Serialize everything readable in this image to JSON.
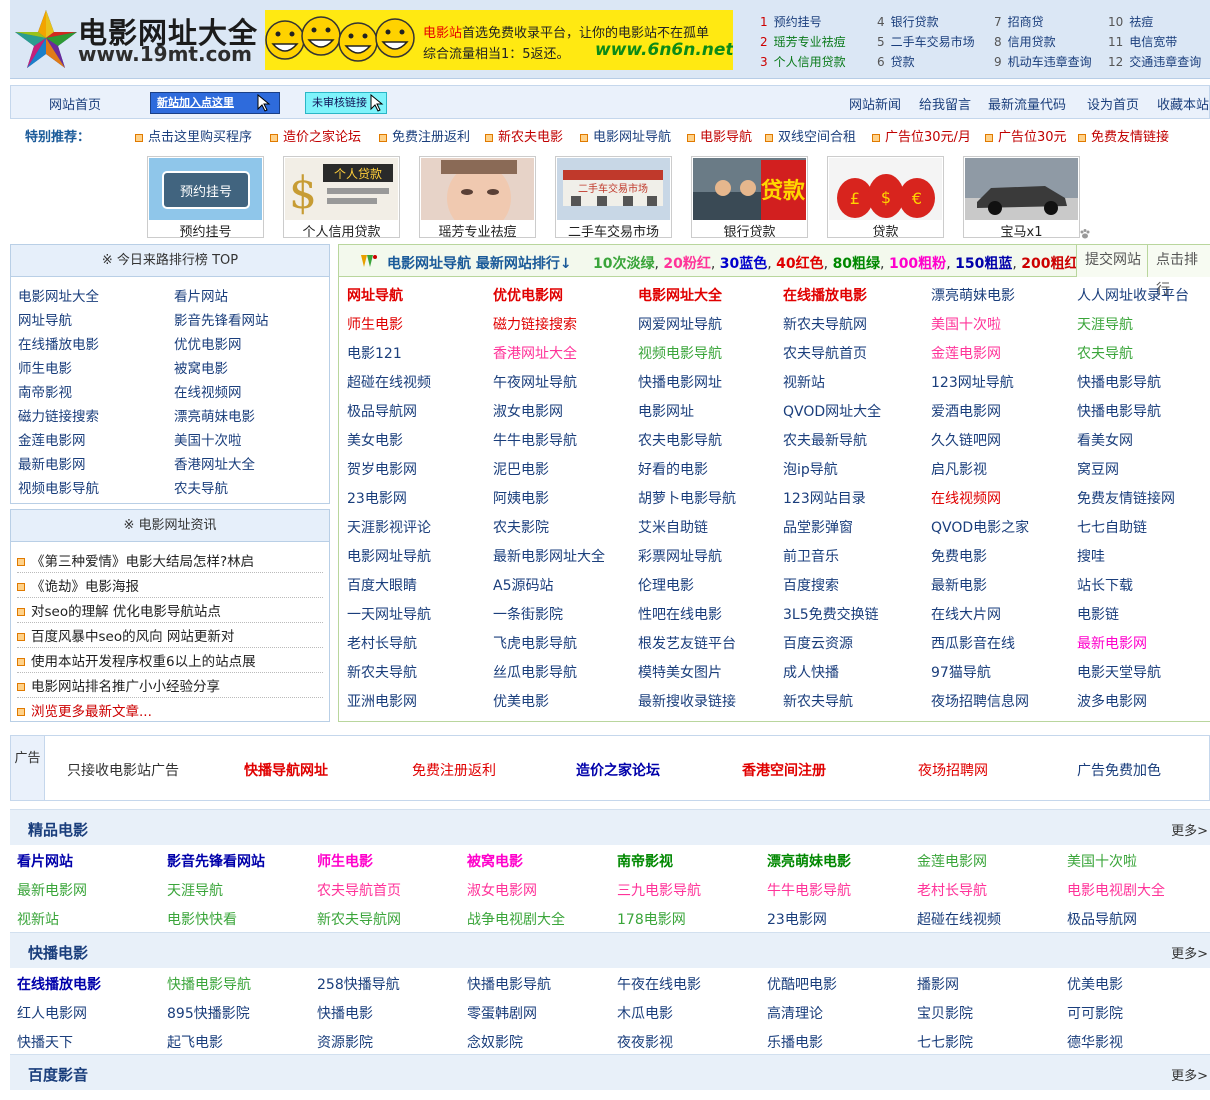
{
  "header": {
    "logo_title": "电影网址大全",
    "logo_url": "www.19mt.com",
    "banner": {
      "line1_highlight": "电影站",
      "line1_rest": "首选免费收录平台，让你的电影站不在孤单",
      "line2": "综合流量相当1：5返还。",
      "url": "www.6n6n.net"
    },
    "toplinks": [
      {
        "num": "1",
        "label": "预约挂号"
      },
      {
        "num": "2",
        "label": "瑶芳专业祛痘"
      },
      {
        "num": "3",
        "label": "个人信用贷款"
      },
      {
        "num": "4",
        "label": "银行贷款"
      },
      {
        "num": "5",
        "label": "二手车交易市场"
      },
      {
        "num": "6",
        "label": "贷款"
      },
      {
        "num": "7",
        "label": "招商贷"
      },
      {
        "num": "8",
        "label": "信用贷款"
      },
      {
        "num": "9",
        "label": "机动车违章查询"
      },
      {
        "num": "10",
        "label": "祛痘"
      },
      {
        "num": "11",
        "label": "电信宽带"
      },
      {
        "num": "12",
        "label": "交通违章查询"
      }
    ]
  },
  "nav": {
    "home": "网站首页",
    "add_site": "新站加入点这里",
    "unreviewed": "未审核链接",
    "right": [
      "网站新闻",
      "给我留言",
      "最新流量代码",
      "设为首页",
      "收藏本站"
    ]
  },
  "special": {
    "title": "特别推荐：",
    "items": [
      {
        "label": "点击这里购买程序",
        "color": "#1a3e7c"
      },
      {
        "label": "造价之家论坛",
        "color": "#c00000"
      },
      {
        "label": "免费注册返利",
        "color": "#1a3e7c"
      },
      {
        "label": "新农夫电影",
        "color": "#c00000"
      },
      {
        "label": "电影网址导航",
        "color": "#1a3e7c"
      },
      {
        "label": "电影导航",
        "color": "#c00000"
      },
      {
        "label": "双线空间合租",
        "color": "#1a3e7c"
      },
      {
        "label": "广告位30元/月",
        "color": "#c00000"
      },
      {
        "label": "广告位30元",
        "color": "#c00000"
      },
      {
        "label": "免费友情链接",
        "color": "#c00000"
      }
    ]
  },
  "thumbs": [
    {
      "caption": "预约挂号",
      "img_text": "预约挂号"
    },
    {
      "caption": "个人信用贷款",
      "img_text": "个人贷款"
    },
    {
      "caption": "瑶芳专业祛痘",
      "img_text": ""
    },
    {
      "caption": "二手车交易市场",
      "img_text": "二手车交易市场"
    },
    {
      "caption": "银行贷款",
      "img_text": "贷款"
    },
    {
      "caption": "贷款",
      "img_text": ""
    },
    {
      "caption": "宝马x1",
      "img_text": ""
    }
  ],
  "rank": {
    "title": "※ 今日来路排行榜 TOP",
    "items": [
      "电影网址大全",
      "看片网站",
      "网址导航",
      "影音先锋看网站",
      "在线播放电影",
      "优优电影网",
      "师生电影",
      "被窝电影",
      "南帝影视",
      "在线视频网",
      "磁力链接搜索",
      "漂亮萌妹电影",
      "金莲电影网",
      "美国十次啦",
      "最新电影网",
      "香港网址大全",
      "视频电影导航",
      "农夫导航"
    ]
  },
  "news": {
    "title": "※ 电影网址资讯",
    "items": [
      "《第三种爱情》电影大结局怎样?林启",
      "《诡劫》电影海报",
      "对seo的理解 优化电影导航站点",
      "百度风暴中seo的风向 网站更新对",
      "使用本站开发程序权重6以上的站点展",
      "电影网站排名推广小小经验分享",
      "浏览更多最新文章..."
    ]
  },
  "main": {
    "title": "电影网址导航 最新网站排行↓",
    "legend": [
      {
        "text": "10次淡绿",
        "color": "#3aa53a"
      },
      {
        "text": "20粉红",
        "color": "#ff3399"
      },
      {
        "text": "30蓝色",
        "color": "#0000cc"
      },
      {
        "text": "40红色",
        "color": "#e00000"
      },
      {
        "text": "80粗绿",
        "color": "#008800"
      },
      {
        "text": "100粗粉",
        "color": "#ff00cc"
      },
      {
        "text": "150粗蓝",
        "color": "#0000aa"
      },
      {
        "text": "200粗红",
        "color": "#cc0000"
      }
    ],
    "tab_submit": "提交网站",
    "tab_rank": "点击排行",
    "links": [
      [
        {
          "t": "网址导航",
          "c": "#e00000",
          "b": true
        },
        {
          "t": "优优电影网",
          "c": "#e00000",
          "b": true
        },
        {
          "t": "电影网址大全",
          "c": "#e00000",
          "b": true
        },
        {
          "t": "在线播放电影",
          "c": "#e00000",
          "b": true
        },
        {
          "t": "漂亮萌妹电影",
          "c": "#1a3e7c"
        },
        {
          "t": "人人网址收录平台",
          "c": "#1a3e7c"
        }
      ],
      [
        {
          "t": "师生电影",
          "c": "#e00000"
        },
        {
          "t": "磁力链接搜索",
          "c": "#e00000"
        },
        {
          "t": "网爱网址导航",
          "c": "#1a3e7c"
        },
        {
          "t": "新农夫导航网",
          "c": "#1a3e7c"
        },
        {
          "t": "美国十次啦",
          "c": "#ff3399"
        },
        {
          "t": "天涯导航",
          "c": "#3aa53a"
        }
      ],
      [
        {
          "t": "电影121",
          "c": "#1a3e7c"
        },
        {
          "t": "香港网址大全",
          "c": "#ff3399"
        },
        {
          "t": "视频电影导航",
          "c": "#3aa53a"
        },
        {
          "t": "农夫导航首页",
          "c": "#1a3e7c"
        },
        {
          "t": "金莲电影网",
          "c": "#ff3399"
        },
        {
          "t": "农夫导航",
          "c": "#3aa53a"
        }
      ],
      [
        {
          "t": "超碰在线视频",
          "c": "#1a3e7c"
        },
        {
          "t": "午夜网址导航",
          "c": "#1a3e7c"
        },
        {
          "t": "快播电影网址",
          "c": "#1a3e7c"
        },
        {
          "t": "视新站",
          "c": "#1a3e7c"
        },
        {
          "t": "123网址导航",
          "c": "#1a3e7c"
        },
        {
          "t": "快播电影导航",
          "c": "#1a3e7c"
        }
      ],
      [
        {
          "t": "极品导航网",
          "c": "#1a3e7c"
        },
        {
          "t": "淑女电影网",
          "c": "#1a3e7c"
        },
        {
          "t": "电影网址",
          "c": "#1a3e7c"
        },
        {
          "t": "QVOD网址大全",
          "c": "#1a3e7c"
        },
        {
          "t": "爱酒电影网",
          "c": "#1a3e7c"
        },
        {
          "t": "快播电影导航",
          "c": "#1a3e7c"
        }
      ],
      [
        {
          "t": "美女电影",
          "c": "#1a3e7c"
        },
        {
          "t": "牛牛电影导航",
          "c": "#1a3e7c"
        },
        {
          "t": "农夫电影导航",
          "c": "#1a3e7c"
        },
        {
          "t": "农夫最新导航",
          "c": "#1a3e7c"
        },
        {
          "t": "久久链吧网",
          "c": "#1a3e7c"
        },
        {
          "t": "看美女网",
          "c": "#1a3e7c"
        }
      ],
      [
        {
          "t": "贺岁电影网",
          "c": "#1a3e7c"
        },
        {
          "t": "泥巴电影",
          "c": "#1a3e7c"
        },
        {
          "t": "好看的电影",
          "c": "#1a3e7c"
        },
        {
          "t": "泡ip导航",
          "c": "#1a3e7c"
        },
        {
          "t": "启凡影视",
          "c": "#1a3e7c"
        },
        {
          "t": "窝豆网",
          "c": "#1a3e7c"
        }
      ],
      [
        {
          "t": "23电影网",
          "c": "#1a3e7c"
        },
        {
          "t": "阿姨电影",
          "c": "#1a3e7c"
        },
        {
          "t": "胡萝卜电影导航",
          "c": "#1a3e7c"
        },
        {
          "t": "123网站目录",
          "c": "#1a3e7c"
        },
        {
          "t": "在线视频网",
          "c": "#e00000"
        },
        {
          "t": "免费友情链接网",
          "c": "#1a3e7c"
        }
      ],
      [
        {
          "t": "天涯影视评论",
          "c": "#1a3e7c"
        },
        {
          "t": "农夫影院",
          "c": "#1a3e7c"
        },
        {
          "t": "艾米自助链",
          "c": "#1a3e7c"
        },
        {
          "t": "品堂影弹窗",
          "c": "#1a3e7c"
        },
        {
          "t": "QVOD电影之家",
          "c": "#1a3e7c"
        },
        {
          "t": "七七自助链",
          "c": "#1a3e7c"
        }
      ],
      [
        {
          "t": "电影网址导航",
          "c": "#1a3e7c"
        },
        {
          "t": "最新电影网址大全",
          "c": "#1a3e7c"
        },
        {
          "t": "彩票网址导航",
          "c": "#1a3e7c"
        },
        {
          "t": "前卫音乐",
          "c": "#1a3e7c"
        },
        {
          "t": "免费电影",
          "c": "#1a3e7c"
        },
        {
          "t": "搜哇",
          "c": "#1a3e7c"
        }
      ],
      [
        {
          "t": "百度大眼睛",
          "c": "#1a3e7c"
        },
        {
          "t": "A5源码站",
          "c": "#1a3e7c"
        },
        {
          "t": "伦理电影",
          "c": "#1a3e7c"
        },
        {
          "t": "百度搜索",
          "c": "#1a3e7c"
        },
        {
          "t": "最新电影",
          "c": "#1a3e7c"
        },
        {
          "t": "站长下载",
          "c": "#1a3e7c"
        }
      ],
      [
        {
          "t": "一天网址导航",
          "c": "#1a3e7c"
        },
        {
          "t": "一条街影院",
          "c": "#1a3e7c"
        },
        {
          "t": "性吧在线电影",
          "c": "#1a3e7c"
        },
        {
          "t": "3L5免费交换链",
          "c": "#1a3e7c"
        },
        {
          "t": "在线大片网",
          "c": "#1a3e7c"
        },
        {
          "t": "电影链",
          "c": "#1a3e7c"
        }
      ],
      [
        {
          "t": "老村长导航",
          "c": "#1a3e7c"
        },
        {
          "t": "飞虎电影导航",
          "c": "#1a3e7c"
        },
        {
          "t": "根发艺友链平台",
          "c": "#1a3e7c"
        },
        {
          "t": "百度云资源",
          "c": "#1a3e7c"
        },
        {
          "t": "西瓜影音在线",
          "c": "#1a3e7c"
        },
        {
          "t": "最新电影网",
          "c": "#ff00cc"
        }
      ],
      [
        {
          "t": "新农夫导航",
          "c": "#1a3e7c"
        },
        {
          "t": "丝瓜电影导航",
          "c": "#1a3e7c"
        },
        {
          "t": "模特美女图片",
          "c": "#1a3e7c"
        },
        {
          "t": "成人快播",
          "c": "#1a3e7c"
        },
        {
          "t": "97猫导航",
          "c": "#1a3e7c"
        },
        {
          "t": "电影天堂导航",
          "c": "#1a3e7c"
        }
      ],
      [
        {
          "t": "亚洲电影网",
          "c": "#1a3e7c"
        },
        {
          "t": "优美电影",
          "c": "#1a3e7c"
        },
        {
          "t": "最新搜收录链接",
          "c": "#1a3e7c"
        },
        {
          "t": "新农夫导航",
          "c": "#1a3e7c"
        },
        {
          "t": "夜场招聘信息网",
          "c": "#1a3e7c"
        },
        {
          "t": "波多电影网",
          "c": "#1a3e7c"
        }
      ]
    ]
  },
  "ad": {
    "label": "广告",
    "items": [
      {
        "t": "只接收电影站广告",
        "c": "#333333",
        "b": false
      },
      {
        "t": "快播导航网址",
        "c": "#e00000",
        "b": true
      },
      {
        "t": "免费注册返利",
        "c": "#e00000",
        "b": false
      },
      {
        "t": "造价之家论坛",
        "c": "#0000aa",
        "b": true
      },
      {
        "t": "香港空间注册",
        "c": "#e00000",
        "b": true
      },
      {
        "t": "夜场招聘网",
        "c": "#e00000",
        "b": false
      },
      {
        "t": "广告免费加色",
        "c": "#1a3e7c",
        "b": false
      }
    ]
  },
  "categories": [
    {
      "title": "精品电影",
      "more": "更多>",
      "rows": [
        [
          {
            "t": "看片网站",
            "c": "#0000aa",
            "b": true
          },
          {
            "t": "影音先锋看网站",
            "c": "#0000aa",
            "b": true
          },
          {
            "t": "师生电影",
            "c": "#ff00cc",
            "b": true
          },
          {
            "t": "被窝电影",
            "c": "#ff00cc",
            "b": true
          },
          {
            "t": "南帝影视",
            "c": "#008800",
            "b": true
          },
          {
            "t": "漂亮萌妹电影",
            "c": "#008800",
            "b": true
          },
          {
            "t": "金莲电影网",
            "c": "#3aa53a"
          },
          {
            "t": "美国十次啦",
            "c": "#3aa53a"
          }
        ],
        [
          {
            "t": "最新电影网",
            "c": "#3aa53a"
          },
          {
            "t": "天涯导航",
            "c": "#3aa53a"
          },
          {
            "t": "农夫导航首页",
            "c": "#ff3399"
          },
          {
            "t": "淑女电影网",
            "c": "#ff3399"
          },
          {
            "t": "三九电影导航",
            "c": "#ff3399"
          },
          {
            "t": "牛牛电影导航",
            "c": "#ff3399"
          },
          {
            "t": "老村长导航",
            "c": "#ff3399"
          },
          {
            "t": "电影电视剧大全",
            "c": "#ff3399"
          }
        ],
        [
          {
            "t": "视新站",
            "c": "#3aa53a"
          },
          {
            "t": "电影快快看",
            "c": "#3aa53a"
          },
          {
            "t": "新农夫导航网",
            "c": "#3aa53a"
          },
          {
            "t": "战争电视剧大全",
            "c": "#3aa53a"
          },
          {
            "t": "178电影网",
            "c": "#3aa53a"
          },
          {
            "t": "23电影网",
            "c": "#1a3e7c"
          },
          {
            "t": "超碰在线视频",
            "c": "#1a3e7c"
          },
          {
            "t": "极品导航网",
            "c": "#1a3e7c"
          }
        ]
      ]
    },
    {
      "title": "快播电影",
      "more": "更多>",
      "rows": [
        [
          {
            "t": "在线播放电影",
            "c": "#0000aa",
            "b": true
          },
          {
            "t": "快播电影导航",
            "c": "#3aa53a"
          },
          {
            "t": "258快播导航",
            "c": "#1a3e7c"
          },
          {
            "t": "快播电影导航",
            "c": "#1a3e7c"
          },
          {
            "t": "午夜在线电影",
            "c": "#1a3e7c"
          },
          {
            "t": "优酷吧电影",
            "c": "#1a3e7c"
          },
          {
            "t": "播影网",
            "c": "#1a3e7c"
          },
          {
            "t": "优美电影",
            "c": "#1a3e7c"
          }
        ],
        [
          {
            "t": "红人电影网",
            "c": "#1a3e7c"
          },
          {
            "t": "895快播影院",
            "c": "#1a3e7c"
          },
          {
            "t": "快播电影",
            "c": "#1a3e7c"
          },
          {
            "t": "零蛋韩剧网",
            "c": "#1a3e7c"
          },
          {
            "t": "木瓜电影",
            "c": "#1a3e7c"
          },
          {
            "t": "高清理论",
            "c": "#1a3e7c"
          },
          {
            "t": "宝贝影院",
            "c": "#1a3e7c"
          },
          {
            "t": "可可影院",
            "c": "#1a3e7c"
          }
        ],
        [
          {
            "t": "快播天下",
            "c": "#1a3e7c"
          },
          {
            "t": "起飞电影",
            "c": "#1a3e7c"
          },
          {
            "t": "资源影院",
            "c": "#1a3e7c"
          },
          {
            "t": "念奴影院",
            "c": "#1a3e7c"
          },
          {
            "t": "夜夜影视",
            "c": "#1a3e7c"
          },
          {
            "t": "乐播电影",
            "c": "#1a3e7c"
          },
          {
            "t": "七七影院",
            "c": "#1a3e7c"
          },
          {
            "t": "德华影视",
            "c": "#1a3e7c"
          }
        ]
      ]
    },
    {
      "title": "百度影音",
      "more": "更多>",
      "rows": []
    }
  ]
}
